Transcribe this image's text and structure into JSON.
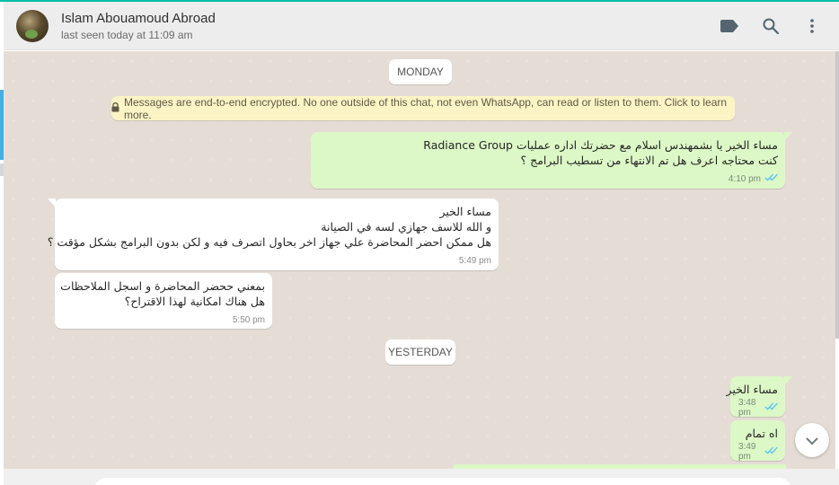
{
  "header": {
    "contact_name": "Islam Abouamoud Abroad",
    "status": "last seen today at 11:09 am",
    "icons": [
      "label-icon",
      "search-icon",
      "menu-icon"
    ]
  },
  "chat": {
    "day_monday": "MONDAY",
    "day_yesterday": "YESTERDAY",
    "encryption_notice": "Messages are end-to-end encrypted. No one outside of this chat, not even WhatsApp, can read or listen to them. Click to learn more.",
    "messages": [
      {
        "direction": "outgoing",
        "lines": [
          "مساء الخير يا بشمهندس اسلام  مع حضرتك اداره عمليات Radiance Group",
          "كنت محتاجه اعرف هل تم الانتهاء من تسطيب البرامج ؟"
        ],
        "time": "4:10 pm",
        "ticks": "read"
      },
      {
        "direction": "incoming",
        "lines": [
          "مساء الخير",
          "و الله للاسف جهازي لسه في الصيانة",
          "هل ممكن احضر المحاضرة علي جهاز اخر بحاول اتصرف فيه و لكن بدون البرامج  بشكل مؤقت ؟"
        ],
        "time": "5:49 pm"
      },
      {
        "direction": "incoming",
        "lines": [
          "بمعني ححضر المحاضرة و اسجل الملاحظات",
          "هل هناك امكانية لهذا الاقتراح؟"
        ],
        "time": "5:50 pm"
      },
      {
        "direction": "outgoing",
        "lines": [
          "مساء الخير"
        ],
        "time": "3:48 pm",
        "ticks": "read"
      },
      {
        "direction": "outgoing",
        "lines": [
          "اه تمام"
        ],
        "time": "3:49 pm",
        "ticks": "read"
      }
    ]
  },
  "colors": {
    "outgoing_bubble": "#dcf8c6",
    "incoming_bubble": "#ffffff",
    "chat_background": "#e5ddd5",
    "read_ticks": "#4fc3f7",
    "encryption_banner": "#fdf4c5",
    "accent": "#00bfa5"
  }
}
